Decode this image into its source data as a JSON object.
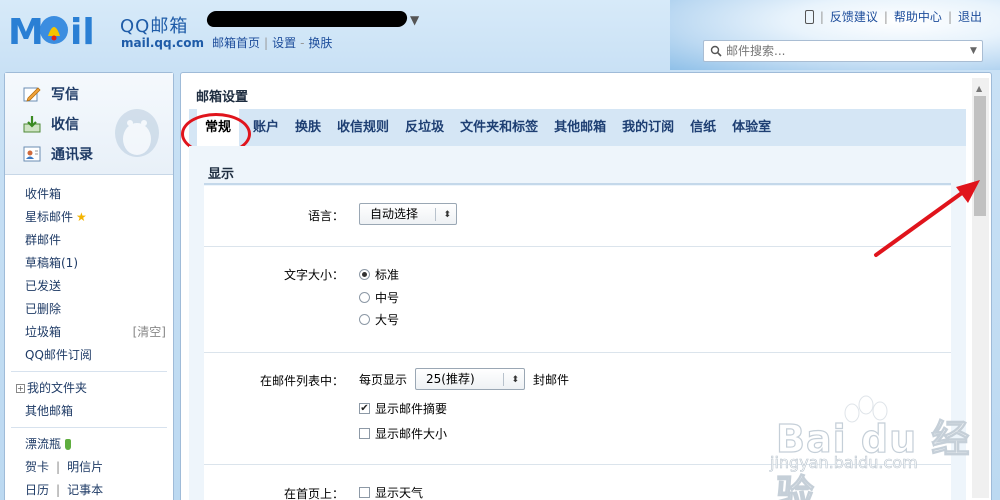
{
  "brand": {
    "logo_text": "MOil",
    "product": "QQ邮箱",
    "domain": "mail.qq.com"
  },
  "top_nav": {
    "home": "邮箱首页",
    "settings": "设置",
    "theme": "换肤",
    "sep_pipe": "|",
    "sep_dash": "-"
  },
  "utility": {
    "feedback": "反馈建议",
    "help": "帮助中心",
    "logout": "退出",
    "sep": "|"
  },
  "search": {
    "placeholder": "邮件搜索..."
  },
  "sidebar": {
    "compose": "写信",
    "inbox_btn": "收信",
    "contacts": "通讯录",
    "folders": {
      "inbox": "收件箱",
      "starred": "星标邮件",
      "group": "群邮件",
      "drafts": "草稿箱(1)",
      "sent": "已发送",
      "deleted": "已删除",
      "spam": "垃圾箱",
      "spam_clear": "[清空]",
      "subscriptions": "QQ邮件订阅",
      "my_folders": "我的文件夹",
      "other_mailbox": "其他邮箱",
      "drift_bottle": "漂流瓶",
      "greeting_card": "贺卡",
      "postcard": "明信片",
      "calendar": "日历",
      "notebook": "记事本",
      "pipe": "|",
      "plus": "+"
    }
  },
  "main": {
    "title": "邮箱设置",
    "tabs": [
      "常规",
      "账户",
      "换肤",
      "收信规则",
      "反垃圾",
      "文件夹和标签",
      "其他邮箱",
      "我的订阅",
      "信纸",
      "体验室"
    ],
    "section_title": "显示",
    "language": {
      "label": "语言：",
      "value": "自动选择"
    },
    "font_size": {
      "label": "文字大小：",
      "options": [
        "标准",
        "中号",
        "大号"
      ],
      "selected": "标准"
    },
    "mail_list": {
      "label": "在邮件列表中：",
      "per_page_prefix": "每页显示",
      "per_page_value": "25(推荐)",
      "per_page_suffix": "封邮件",
      "show_summary": "显示邮件摘要",
      "show_summary_checked": true,
      "show_size": "显示邮件大小",
      "show_size_checked": false
    },
    "homepage": {
      "label": "在首页上：",
      "show_weather": "显示天气"
    }
  },
  "watermark": {
    "text": "Bai du 经验",
    "url": "jingyan.baidu.com"
  },
  "colors": {
    "link": "#1d4d9b",
    "tab_bg": "#d5e6f5",
    "annotation_red": "#e0141c"
  }
}
